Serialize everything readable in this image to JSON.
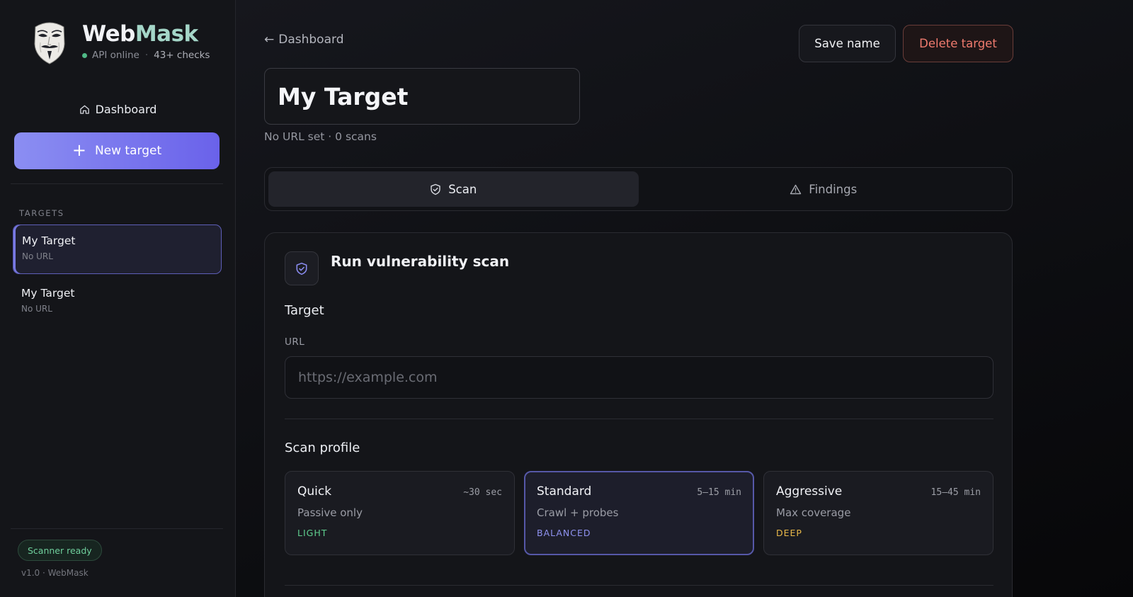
{
  "brand": {
    "name_part1": "Web",
    "name_part2": "Mask",
    "status": "API online",
    "separator": "·",
    "checks": "43+ checks"
  },
  "sidebar": {
    "dashboard_label": "Dashboard",
    "new_target_label": "New target",
    "section_label": "TARGETS",
    "targets": [
      {
        "name": "My Target",
        "url": "No URL",
        "active": true
      },
      {
        "name": "My Target",
        "url": "No URL",
        "active": false
      }
    ],
    "scanner_status": "Scanner ready",
    "version": "v1.0 · WebMask"
  },
  "header": {
    "back_label": "Dashboard",
    "save_label": "Save name",
    "delete_label": "Delete target",
    "target_name": "My Target",
    "meta": "No URL set · 0 scans"
  },
  "tabs": [
    {
      "label": "Scan",
      "icon": "shield-check-icon",
      "active": true
    },
    {
      "label": "Findings",
      "icon": "warning-triangle-icon",
      "active": false
    }
  ],
  "scan_card": {
    "title": "Run vulnerability scan",
    "target_section": "Target",
    "url_label": "URL",
    "url_value": "",
    "url_placeholder": "https://example.com",
    "profile_section": "Scan profile",
    "profiles": [
      {
        "name": "Quick",
        "time": "~30 sec",
        "desc": "Passive only",
        "tag": "LIGHT",
        "tag_color": "#5fcf8f",
        "selected": false
      },
      {
        "name": "Standard",
        "time": "5–15 min",
        "desc": "Crawl + probes",
        "tag": "BALANCED",
        "tag_color": "#8f92f0",
        "selected": true
      },
      {
        "name": "Aggressive",
        "time": "15–45 min",
        "desc": "Max coverage",
        "tag": "DEEP",
        "tag_color": "#e9b949",
        "selected": false
      }
    ]
  },
  "colors": {
    "accent": "#6a62ea",
    "danger": "#f07b6e",
    "success": "#6fcf9c"
  }
}
